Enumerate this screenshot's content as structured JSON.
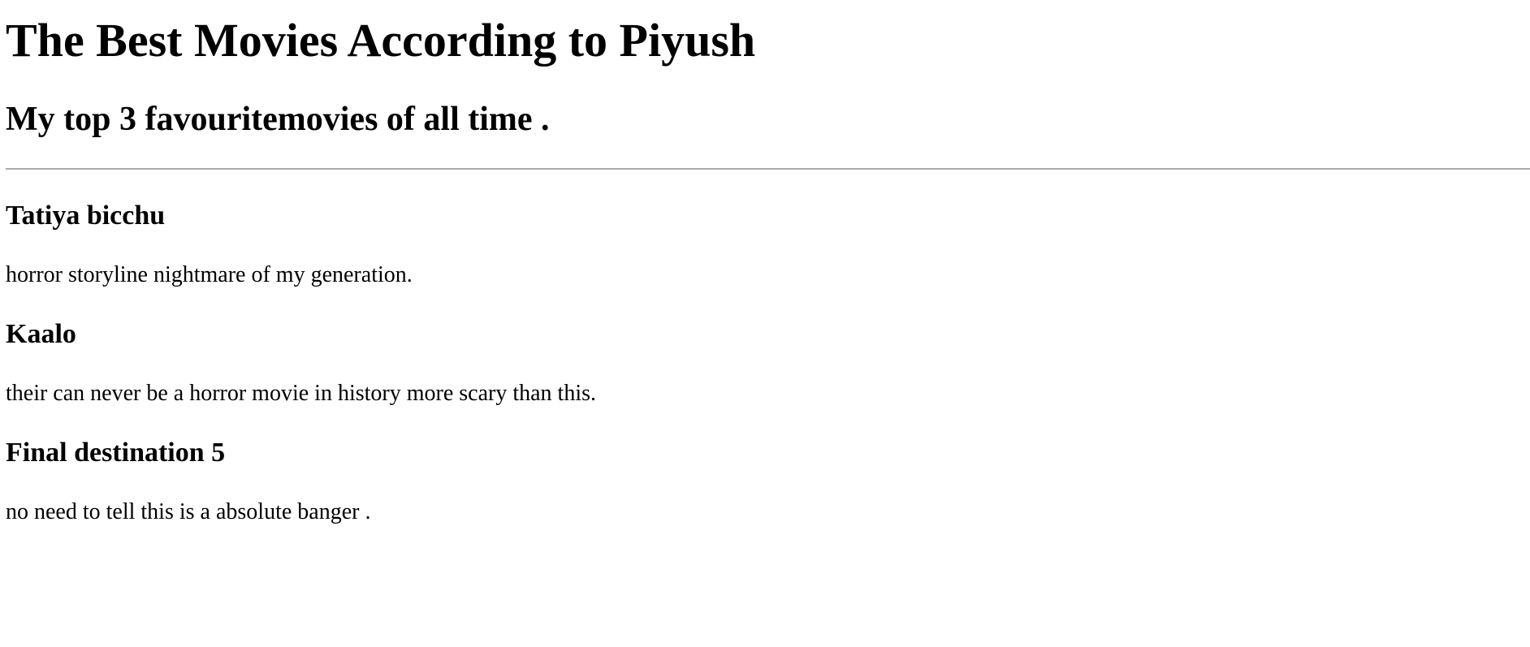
{
  "header": {
    "title": "The Best Movies According to Piyush",
    "subtitle": "My top 3 favouritemovies of all time ."
  },
  "movies": [
    {
      "title": "Tatiya bicchu",
      "description": "horror storyline nightmare of my generation."
    },
    {
      "title": "Kaalo",
      "description": "their can never be a horror movie in history more scary than this."
    },
    {
      "title": "Final destination 5",
      "description": "no need to tell this is a absolute banger ."
    }
  ]
}
